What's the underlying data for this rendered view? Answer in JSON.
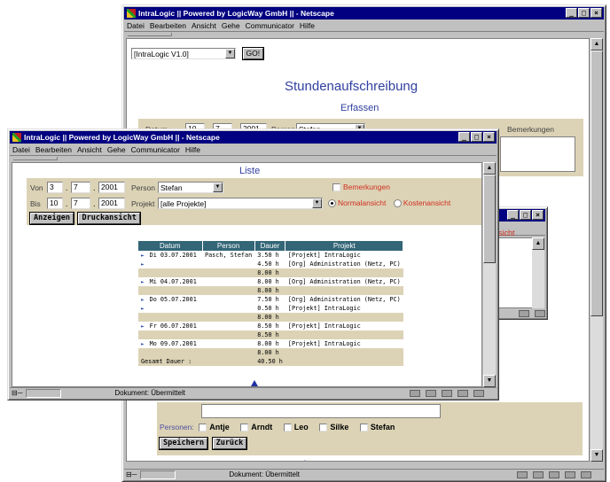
{
  "back_window": {
    "title": "IntraLogic || Powered by LogicWay GmbH || - Netscape",
    "menu": [
      "Datei",
      "Bearbeiten",
      "Ansicht",
      "Gehe",
      "Communicator",
      "Hilfe"
    ],
    "app_select": "[IntraLogic V1.0]",
    "go_label": "GO!",
    "page_title": "Stundenaufschreibung",
    "section_title": "Erfassen",
    "datum_label": "Datum",
    "datum_day": "10",
    "datum_month": "7",
    "datum_year": "2001",
    "person_label": "Person",
    "person_value": "Stefan",
    "bemerkungen_label": "Bemerkungen",
    "personen_label": "Personen:",
    "personen": [
      "Antje",
      "Arndt",
      "Leo",
      "Silke",
      "Stefan"
    ],
    "speichern_label": "Speichern",
    "zurueck_label": "Zurück",
    "status": "Dokument: Übermittelt"
  },
  "third_window": {
    "ansicht_fragment": "nsicht"
  },
  "front_window": {
    "title": "IntraLogic || Powered by LogicWay GmbH || - Netscape",
    "menu": [
      "Datei",
      "Bearbeiten",
      "Ansicht",
      "Gehe",
      "Communicator",
      "Hilfe"
    ],
    "heading": "Liste",
    "von_label": "Von",
    "von_day": "3",
    "von_month": "7",
    "von_year": "2001",
    "bis_label": "Bis",
    "bis_day": "10",
    "bis_month": "7",
    "bis_year": "2001",
    "person_label": "Person",
    "person_value": "Stefan",
    "projekt_label": "Projekt",
    "projekt_value": "[alle Projekte]",
    "bemerkungen_label": "Bemerkungen",
    "normalansicht_label": "Normalansicht",
    "kostenansicht_label": "Kostenansicht",
    "anzeigen_label": "Anzeigen",
    "druckansicht_label": "Druckansicht",
    "table": {
      "headers": [
        "Datum",
        "Person",
        "Dauer",
        "Projekt"
      ],
      "rows": [
        {
          "bullet": true,
          "datum": "Di 03.07.2001",
          "person": "Pasch, Stefan",
          "dauer": "3.50 h",
          "projekt": "[Projekt] IntraLogic",
          "style": "r1"
        },
        {
          "bullet": true,
          "datum": "",
          "person": "",
          "dauer": "4.50 h",
          "projekt": "[Org] Administration (Netz, PC)",
          "style": "r1"
        },
        {
          "bullet": false,
          "datum": "",
          "person": "",
          "dauer": "8.00 h",
          "projekt": "",
          "style": "r2"
        },
        {
          "bullet": true,
          "datum": "Mi 04.07.2001",
          "person": "",
          "dauer": "8.00 h",
          "projekt": "[Org] Administration (Netz, PC)",
          "style": "r1"
        },
        {
          "bullet": false,
          "datum": "",
          "person": "",
          "dauer": "8.00 h",
          "projekt": "",
          "style": "r2"
        },
        {
          "bullet": true,
          "datum": "Do 05.07.2001",
          "person": "",
          "dauer": "7.50 h",
          "projekt": "[Org] Administration (Netz, PC)",
          "style": "r1"
        },
        {
          "bullet": true,
          "datum": "",
          "person": "",
          "dauer": "0.50 h",
          "projekt": "[Projekt] IntraLogic",
          "style": "r1"
        },
        {
          "bullet": false,
          "datum": "",
          "person": "",
          "dauer": "8.00 h",
          "projekt": "",
          "style": "r2"
        },
        {
          "bullet": true,
          "datum": "Fr 06.07.2001",
          "person": "",
          "dauer": "8.50 h",
          "projekt": "[Projekt] IntraLogic",
          "style": "r1"
        },
        {
          "bullet": false,
          "datum": "",
          "person": "",
          "dauer": "8.50 h",
          "projekt": "",
          "style": "r2"
        },
        {
          "bullet": true,
          "datum": "Mo 09.07.2001",
          "person": "",
          "dauer": "8.00 h",
          "projekt": "[Projekt] IntraLogic",
          "style": "r1"
        },
        {
          "bullet": false,
          "datum": "",
          "person": "",
          "dauer": "8.00 h",
          "projekt": "",
          "style": "r2"
        }
      ],
      "total_label": "Gesamt Dauer :",
      "total_value": "40.50 h"
    },
    "status": "Dokument: Übermittelt"
  },
  "colors": {
    "titlebar": "#000080",
    "panel": "#dcd3b6",
    "table_header": "#336677",
    "heading_blue": "#3040a0",
    "red_label": "#d03020"
  }
}
